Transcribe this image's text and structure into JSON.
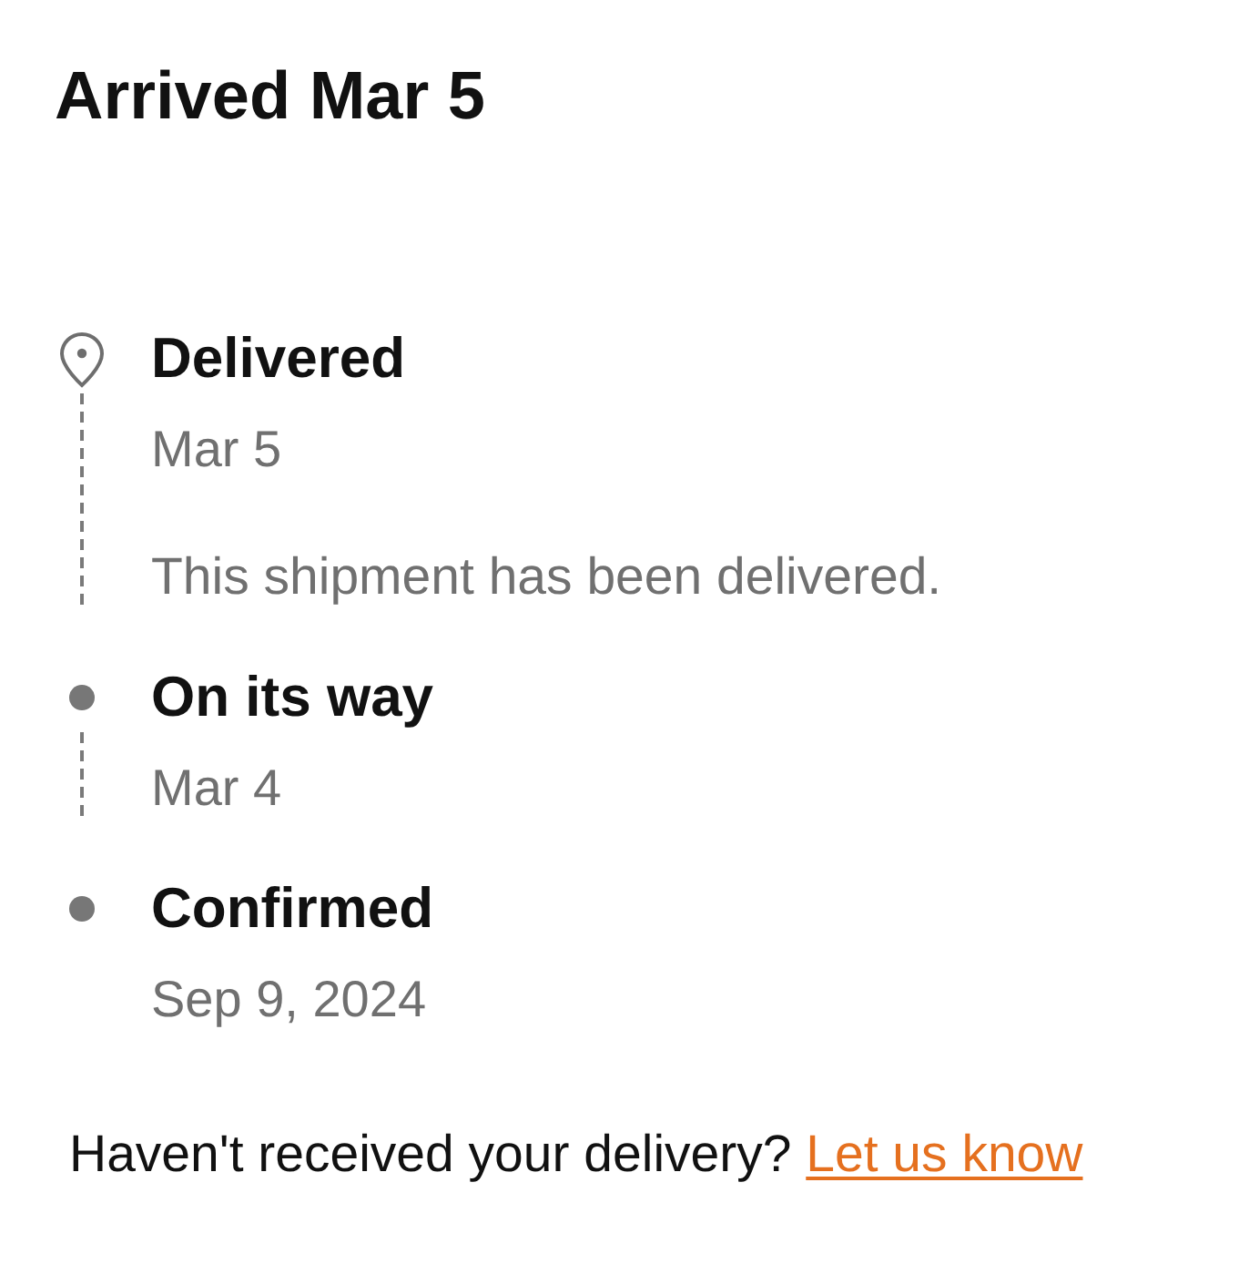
{
  "title": "Arrived Mar 5",
  "timeline": [
    {
      "kind": "pin",
      "status": "Delivered",
      "date": "Mar 5",
      "note": "This shipment has been delivered."
    },
    {
      "kind": "dot",
      "status": "On its way",
      "date": "Mar 4"
    },
    {
      "kind": "dot",
      "status": "Confirmed",
      "date": "Sep 9, 2024"
    }
  ],
  "footer": {
    "text": "Haven't received your delivery?",
    "link": "Let us know"
  }
}
